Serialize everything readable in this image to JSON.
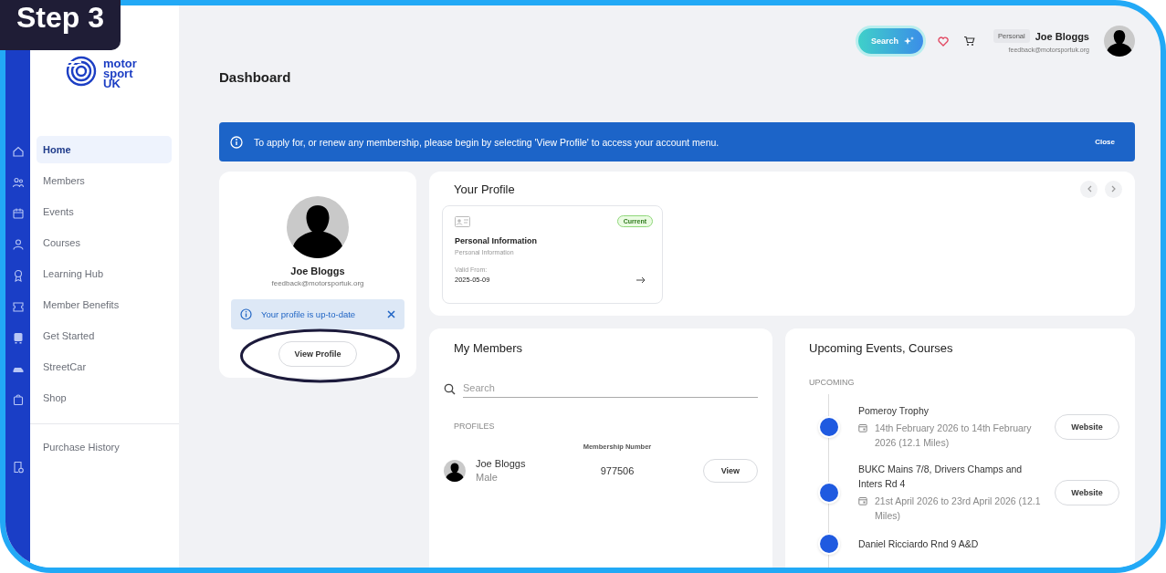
{
  "step_badge": "Step 3",
  "logo_lines": [
    "motor",
    "sport",
    "UK"
  ],
  "sidebar": {
    "items": [
      {
        "label": "Home",
        "selected": true
      },
      {
        "label": "Members",
        "selected": false
      },
      {
        "label": "Events",
        "selected": false
      },
      {
        "label": "Courses",
        "selected": false
      },
      {
        "label": "Learning Hub",
        "selected": false
      },
      {
        "label": "Member Benefits",
        "selected": false
      },
      {
        "label": "Get Started",
        "selected": false
      },
      {
        "label": "StreetCar",
        "selected": false
      },
      {
        "label": "Shop",
        "selected": false
      }
    ],
    "footer_items": [
      {
        "label": "Purchase History",
        "selected": false
      }
    ]
  },
  "topbar": {
    "search_button": "Search",
    "account_type": "Personal",
    "user_name": "Joe Bloggs",
    "user_email": "feedback@motorsportuk.org"
  },
  "page_title": "Dashboard",
  "banner": {
    "message": "To apply for, or renew any membership, please begin by selecting 'View Profile' to access your account menu.",
    "close": "Close"
  },
  "profile_card": {
    "name": "Joe Bloggs",
    "email": "feedback@motorsportuk.org",
    "notice": "Your profile is up-to-date",
    "button": "View Profile"
  },
  "your_profile": {
    "title": "Your Profile",
    "cards": [
      {
        "status": "Current",
        "title": "Personal Information",
        "subtitle": "Personal Information",
        "valid_label": "Valid From:",
        "valid_date": "2025-05-09"
      }
    ]
  },
  "my_members": {
    "title": "My Members",
    "search": {
      "placeholder": "Search"
    },
    "section_label": "PROFILES",
    "columns": [
      "Membership Number"
    ],
    "rows": [
      {
        "name": "Joe Bloggs",
        "gender": "Male",
        "membership_number": "977506",
        "action": "View"
      }
    ]
  },
  "upcoming": {
    "title": "Upcoming Events, Courses",
    "section_label": "UPCOMING",
    "events": [
      {
        "title": "Pomeroy Trophy",
        "dates": "14th February 2026 to 14th February 2026 (12.1 Miles)",
        "action": "Website"
      },
      {
        "title": "BUKC Mains 7/8, Drivers Champs and Inters Rd 4",
        "dates": "21st April 2026 to 23rd April 2026 (12.1 Miles)",
        "action": "Website"
      },
      {
        "title": "Daniel Ricciardo Rnd 9 A&D"
      }
    ]
  }
}
